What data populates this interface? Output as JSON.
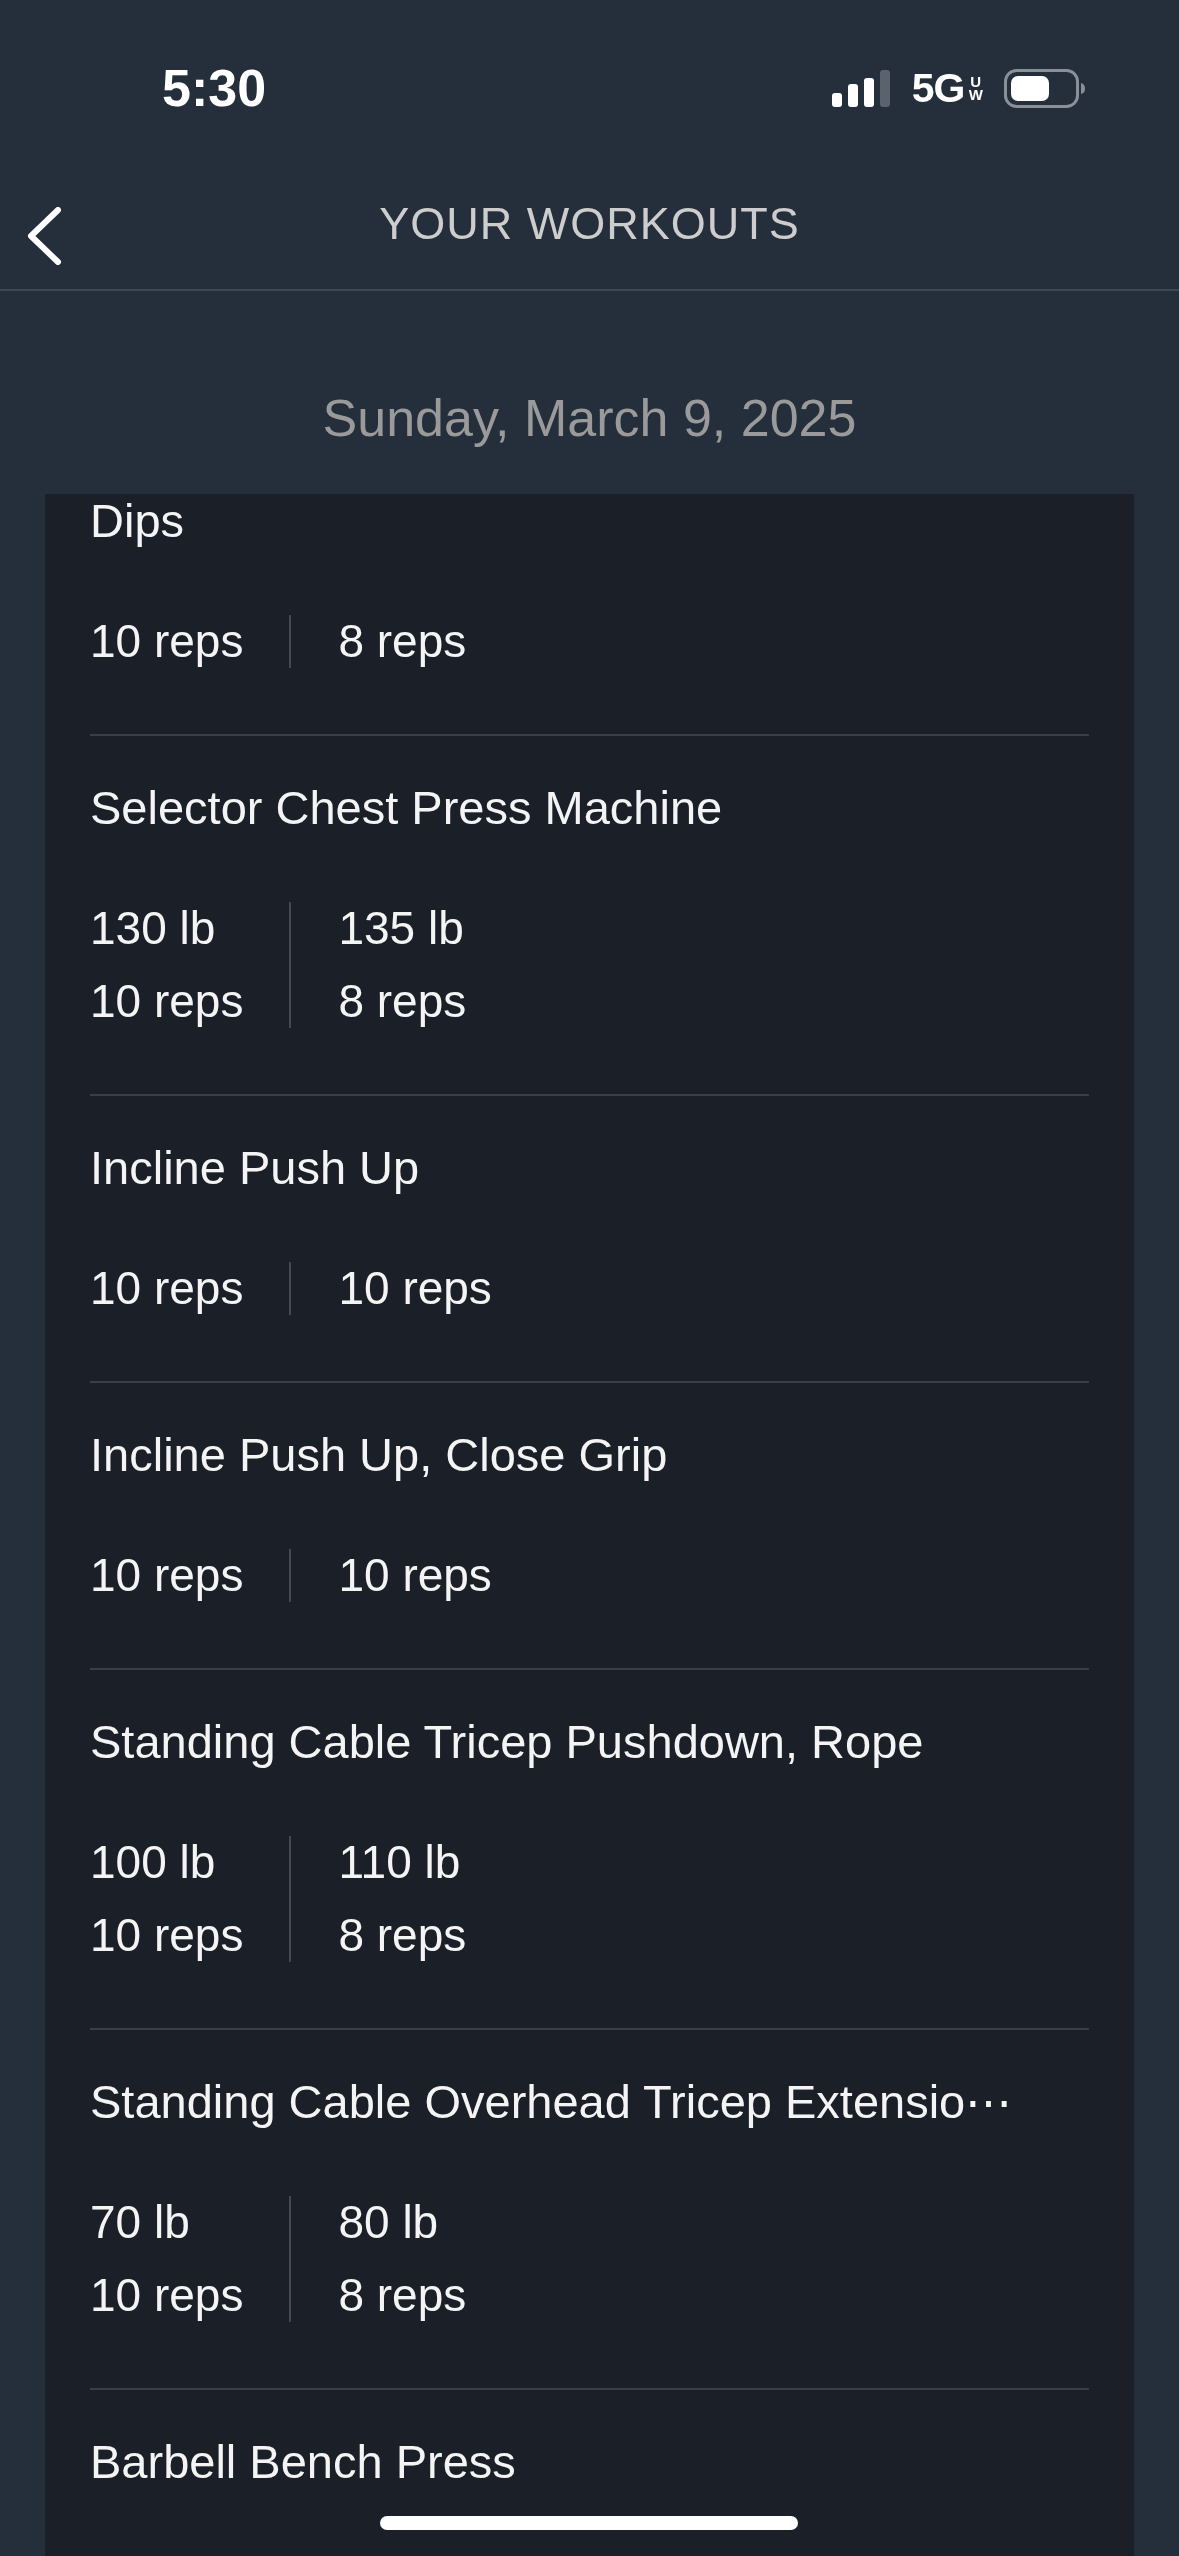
{
  "status_bar": {
    "time": "5:30",
    "network": "5G",
    "network_badge": "UW"
  },
  "nav": {
    "title": "YOUR WORKOUTS"
  },
  "date": "Sunday, March 9, 2025",
  "exercises": [
    {
      "name": "Dips",
      "sets": [
        {
          "reps": "10 reps"
        },
        {
          "reps": "8 reps"
        }
      ]
    },
    {
      "name": "Selector Chest Press Machine",
      "sets": [
        {
          "weight": "130 lb",
          "reps": "10 reps"
        },
        {
          "weight": "135 lb",
          "reps": "8 reps"
        }
      ]
    },
    {
      "name": "Incline Push Up",
      "sets": [
        {
          "reps": "10 reps"
        },
        {
          "reps": "10 reps"
        }
      ]
    },
    {
      "name": "Incline Push Up, Close Grip",
      "sets": [
        {
          "reps": "10 reps"
        },
        {
          "reps": "10 reps"
        }
      ]
    },
    {
      "name": "Standing Cable Tricep Pushdown, Rope",
      "sets": [
        {
          "weight": "100 lb",
          "reps": "10 reps"
        },
        {
          "weight": "110 lb",
          "reps": "8 reps"
        }
      ]
    },
    {
      "name": "Standing Cable Overhead Tricep Extensio⋯",
      "sets": [
        {
          "weight": "70 lb",
          "reps": "10 reps"
        },
        {
          "weight": "80 lb",
          "reps": "8 reps"
        }
      ]
    },
    {
      "name": "Barbell Bench Press"
    }
  ]
}
